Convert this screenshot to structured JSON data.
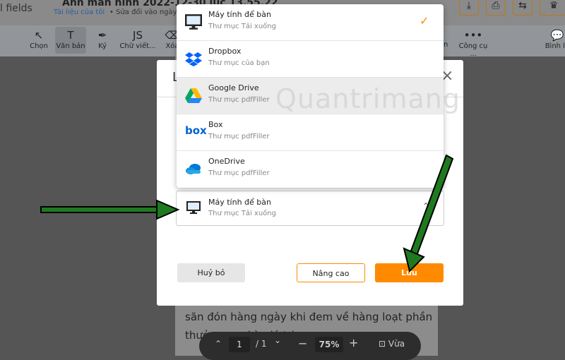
{
  "header": {
    "left_text": "l fields",
    "doc_title": "Ảnh màn hình 2022-12-30 lúc 13.55.22",
    "breadcrumb": "Tài liệu của tôi",
    "modified": "Sửa đổi vào ngày",
    "buttons": [
      "download-icon",
      "print-icon",
      "convert-icon",
      "crown-icon"
    ]
  },
  "toolbar": {
    "tools": [
      {
        "label": "Chọn",
        "icon": "↖"
      },
      {
        "label": "Văn bản",
        "icon": "T"
      },
      {
        "label": "Ký",
        "icon": "✒"
      },
      {
        "label": "Chữ viết...",
        "icon": "JS"
      },
      {
        "label": "Xóa",
        "icon": "⌫"
      }
    ],
    "more": "Công cụ ...",
    "more_icon": "•••",
    "partial": "n",
    "comment": "Bình lu",
    "comment_icon": "💬"
  },
  "dialog": {
    "title": "L",
    "close": "×",
    "selected": {
      "name": "Máy tính để bàn",
      "sub": "Thư mục Tải xuống"
    },
    "cancel": "Huỷ bỏ",
    "advanced": "Nâng cao",
    "save": "Lưu"
  },
  "dropdown": {
    "options": [
      {
        "name": "Máy tính để bàn",
        "sub": "Thư mục Tải xuống",
        "checked": true
      },
      {
        "name": "Dropbox",
        "sub": "Thư mục của bạn"
      },
      {
        "name": "Google Drive",
        "sub": "Thư mục pdfFiller"
      },
      {
        "name": "Box",
        "sub": "Thư mục pdfFiller"
      },
      {
        "name": "OneDrive",
        "sub": "Thư mục pdfFiller"
      }
    ],
    "check": "✓"
  },
  "document": {
    "line1": "săn đón hàng ngày khi đem về hàng loạt phần",
    "line2": "thưởng cực kỳ giá trị"
  },
  "nav": {
    "page": "1",
    "total": "/ 1",
    "zoom": "75%",
    "fit": "Vừa",
    "minus": "−",
    "plus": "+",
    "up": "⌃",
    "down": "⌄"
  },
  "watermark": "Quantrimang",
  "colors": {
    "accent": "#ff8a00",
    "arrow": "#1f7a1f"
  }
}
